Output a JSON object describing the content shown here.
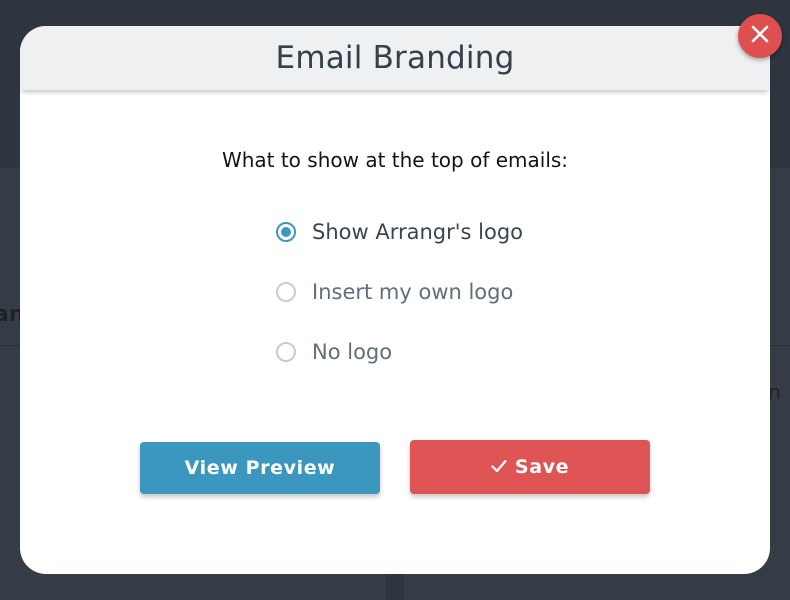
{
  "modal": {
    "title": "Email Branding",
    "prompt": "What to show at the top of emails:",
    "options": [
      {
        "label": "Show Arrangr's logo",
        "selected": true
      },
      {
        "label": "Insert my own logo",
        "selected": false
      },
      {
        "label": "No logo",
        "selected": false
      }
    ],
    "preview_label": "View Preview",
    "save_label": "Save",
    "save_icon": "check-icon",
    "close_icon": "close-icon"
  },
  "background": {
    "fragment_left": "an",
    "fragment_right": "r in"
  },
  "colors": {
    "accent_blue": "#3b97be",
    "save_red": "#df5555",
    "close_red": "#e04f4f",
    "header_bg": "#eef0f1",
    "overlay_bg": "#2f353e"
  }
}
